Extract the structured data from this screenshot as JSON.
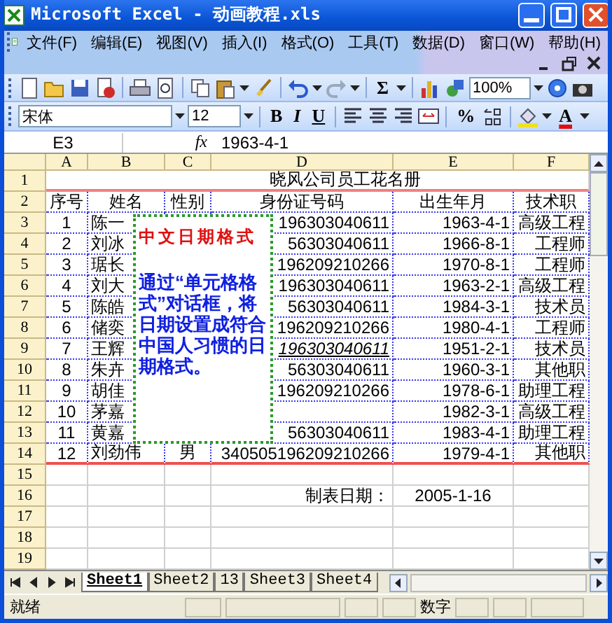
{
  "window": {
    "title": "Microsoft Excel - 动画教程.xls"
  },
  "menu": [
    "文件(F)",
    "编辑(E)",
    "视图(V)",
    "插入(I)",
    "格式(O)",
    "工具(T)",
    "数据(D)",
    "窗口(W)",
    "帮助(H)"
  ],
  "toolbar": {
    "sum": "Σ",
    "zoom": "100%"
  },
  "format_bar": {
    "font": "宋体",
    "size": "12",
    "bold": "B",
    "italic": "I",
    "underline": "U",
    "percent": "%",
    "font_color": "A"
  },
  "formula_bar": {
    "name_box": "E3",
    "function_label": "fx",
    "value": "1963-4-1"
  },
  "sheet": {
    "columns": [
      "A",
      "B",
      "C",
      "D",
      "E",
      "F"
    ],
    "rows": [
      {
        "number": "1",
        "title": "晓风公司员工花名册"
      },
      {
        "number": "2",
        "cells": {
          "A": "序号",
          "B": "姓名",
          "C": "性别",
          "D": "身份证号码",
          "E": "出生年月",
          "F": "技术职"
        }
      },
      {
        "number": "3",
        "cells": {
          "A": "1",
          "B": "陈一",
          "D": "196303040611",
          "E": "1963-4-1",
          "F": "高级工程"
        }
      },
      {
        "number": "4",
        "cells": {
          "A": "2",
          "B": "刘冰",
          "D": "56303040611",
          "E": "1966-8-1",
          "F": "工程师"
        }
      },
      {
        "number": "5",
        "cells": {
          "A": "3",
          "B": "琚长",
          "D": "196209210266",
          "E": "1970-8-1",
          "F": "工程师"
        }
      },
      {
        "number": "6",
        "cells": {
          "A": "4",
          "B": "刘大",
          "D": "196303040611",
          "E": "1963-2-1",
          "F": "高级工程"
        }
      },
      {
        "number": "7",
        "cells": {
          "A": "5",
          "B": "陈皓",
          "D": "56303040611",
          "E": "1984-3-1",
          "F": "技术员"
        }
      },
      {
        "number": "8",
        "cells": {
          "A": "6",
          "B": "储奕",
          "D": "196209210266",
          "E": "1980-4-1",
          "F": "工程师"
        }
      },
      {
        "number": "9",
        "cells": {
          "A": "7",
          "B": "王辉",
          "D": {
            "text": "196303040611",
            "italic": true
          },
          "E": "1951-2-1",
          "F": "技术员"
        }
      },
      {
        "number": "10",
        "cells": {
          "A": "8",
          "B": "朱卉",
          "D": "56303040611",
          "E": "1960-3-1",
          "F": "其他职"
        }
      },
      {
        "number": "11",
        "cells": {
          "A": "9",
          "B": "胡佳",
          "D": "196209210266",
          "E": "1978-6-1",
          "F": "助理工程"
        }
      },
      {
        "number": "12",
        "cells": {
          "A": "10",
          "B": "茅嘉",
          "E": "1982-3-1",
          "F": "高级工程"
        }
      },
      {
        "number": "13",
        "cells": {
          "A": "11",
          "B": "黄嘉",
          "D": "56303040611",
          "E": "1983-4-1",
          "F": "助理工程"
        }
      },
      {
        "number": "14",
        "cells": {
          "A": "12",
          "B": "刘劲伟",
          "C": "男",
          "D": "340505196209210266",
          "E": "1979-4-1",
          "F": "其他职"
        }
      },
      {
        "number": "15"
      },
      {
        "number": "16",
        "cells": {
          "D": "制表日期：",
          "E": "2005-1-16"
        }
      },
      {
        "number": "17"
      },
      {
        "number": "18"
      },
      {
        "number": "19"
      }
    ]
  },
  "comment": {
    "title": "中文日期格式",
    "text": "通过“单元格格式”对话框，将日期设置成符合中国人习惯的日期格式。"
  },
  "sheet_tabs": [
    {
      "label": "Sheet1",
      "selected": true
    },
    {
      "label": "Sheet2",
      "selected": false
    },
    {
      "label": "13",
      "selected": false
    },
    {
      "label": "Sheet3",
      "selected": false
    },
    {
      "label": "Sheet4",
      "selected": false
    }
  ],
  "status_bar": {
    "mode": "就绪",
    "indicator": "数字"
  }
}
